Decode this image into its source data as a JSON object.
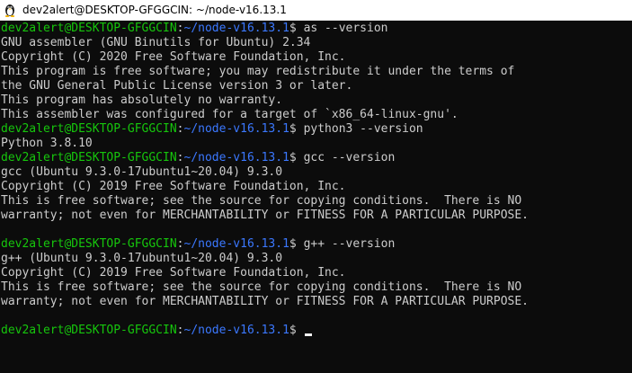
{
  "window": {
    "title": "dev2alert@DESKTOP-GFGGCIN: ~/node-v16.13.1",
    "app_icon": "linux-penguin-icon"
  },
  "colors": {
    "background": "#0c0c0c",
    "text": "#cccccc",
    "user_host": "#16c60c",
    "path": "#3b78ff",
    "cursor": "#f2f2f2"
  },
  "prompt": {
    "user_host": "dev2alert@DESKTOP-GFGGCIN",
    "separator": ":",
    "path": "~/node-v16.13.1",
    "symbol": "$ "
  },
  "session": [
    {
      "command": "as --version",
      "output": [
        "GNU assembler (GNU Binutils for Ubuntu) 2.34",
        "Copyright (C) 2020 Free Software Foundation, Inc.",
        "This program is free software; you may redistribute it under the terms of",
        "the GNU General Public License version 3 or later.",
        "This program has absolutely no warranty.",
        "This assembler was configured for a target of `x86_64-linux-gnu'."
      ]
    },
    {
      "command": "python3 --version",
      "output": [
        "Python 3.8.10"
      ]
    },
    {
      "command": "gcc --version",
      "output": [
        "gcc (Ubuntu 9.3.0-17ubuntu1~20.04) 9.3.0",
        "Copyright (C) 2019 Free Software Foundation, Inc.",
        "This is free software; see the source for copying conditions.  There is NO",
        "warranty; not even for MERCHANTABILITY or FITNESS FOR A PARTICULAR PURPOSE.",
        ""
      ]
    },
    {
      "command": "g++ --version",
      "output": [
        "g++ (Ubuntu 9.3.0-17ubuntu1~20.04) 9.3.0",
        "Copyright (C) 2019 Free Software Foundation, Inc.",
        "This is free software; see the source for copying conditions.  There is NO",
        "warranty; not even for MERCHANTABILITY or FITNESS FOR A PARTICULAR PURPOSE.",
        ""
      ]
    },
    {
      "command": "",
      "output": []
    }
  ]
}
